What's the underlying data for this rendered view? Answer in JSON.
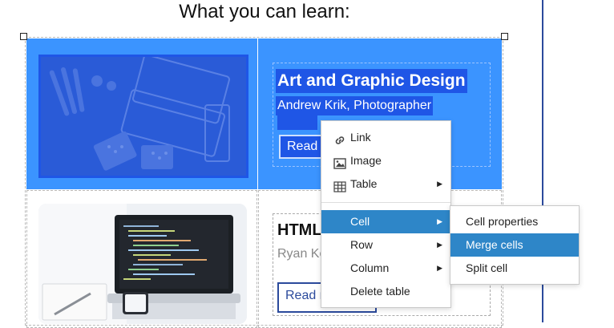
{
  "heading": "What you can learn:",
  "cards": [
    {
      "title": "Art and Graphic Design",
      "subtitle": "Andrew Krik, Photographer",
      "button": "Read more"
    },
    {
      "title": "HTML",
      "subtitle": "Ryan Ke",
      "button": "Read more"
    }
  ],
  "context_menu": {
    "items": [
      {
        "label": "Link",
        "icon": "link-icon",
        "submenu": false
      },
      {
        "label": "Image",
        "icon": "image-icon",
        "submenu": false
      },
      {
        "label": "Table",
        "icon": "table-icon",
        "submenu": true
      },
      {
        "label": "Cell",
        "icon": "",
        "submenu": true,
        "active": true
      },
      {
        "label": "Row",
        "icon": "",
        "submenu": true
      },
      {
        "label": "Column",
        "icon": "",
        "submenu": true
      },
      {
        "label": "Delete table",
        "icon": "",
        "submenu": false
      }
    ],
    "arrow_glyph": "▶"
  },
  "cell_submenu": {
    "items": [
      {
        "label": "Cell properties"
      },
      {
        "label": "Merge cells",
        "active": true
      },
      {
        "label": "Split cell"
      }
    ]
  },
  "colors": {
    "selection": "#3b94ff",
    "selection_text_bg": "#1f56e6",
    "menu_highlight": "#2e86c8",
    "button_border": "#2b4a9c"
  }
}
